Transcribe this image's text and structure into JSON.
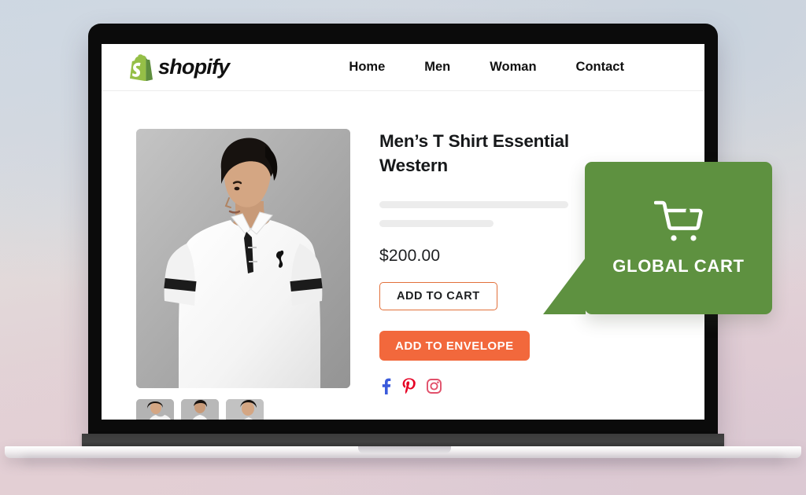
{
  "site": {
    "brand_name": "shopify",
    "brand_logo_icon": "shopify-bag-icon",
    "nav": [
      {
        "label": "Home"
      },
      {
        "label": "Men"
      },
      {
        "label": "Woman"
      },
      {
        "label": "Contact"
      }
    ]
  },
  "product": {
    "title": "Men’s T Shirt Essential Western",
    "price": "$200.00",
    "add_to_cart_label": "ADD TO CART",
    "add_to_envelope_label": "ADD TO ENVELOPE",
    "hero_image_alt": "Man wearing white polo shirt",
    "thumbnails": [
      {
        "alt": "Front view of white polo shirt"
      },
      {
        "alt": "Back view of white polo shirt"
      },
      {
        "alt": "Side view of white polo shirt"
      }
    ],
    "socials": [
      {
        "name": "facebook-icon",
        "color": "#3b5bdb"
      },
      {
        "name": "pinterest-icon",
        "color": "#e60023"
      },
      {
        "name": "instagram-icon",
        "color": "#e1506a"
      }
    ]
  },
  "callout": {
    "label": "GLOBAL CART",
    "icon": "shopping-cart-icon",
    "background_color": "#5e9140",
    "text_color": "#ffffff"
  },
  "colors": {
    "accent_orange": "#f2683c",
    "accent_orange_border": "#e2703a",
    "callout_green": "#5e9140",
    "shopify_green": "#95bf47",
    "skeleton_gray": "#ececec",
    "bezel_black": "#0b0b0b"
  }
}
